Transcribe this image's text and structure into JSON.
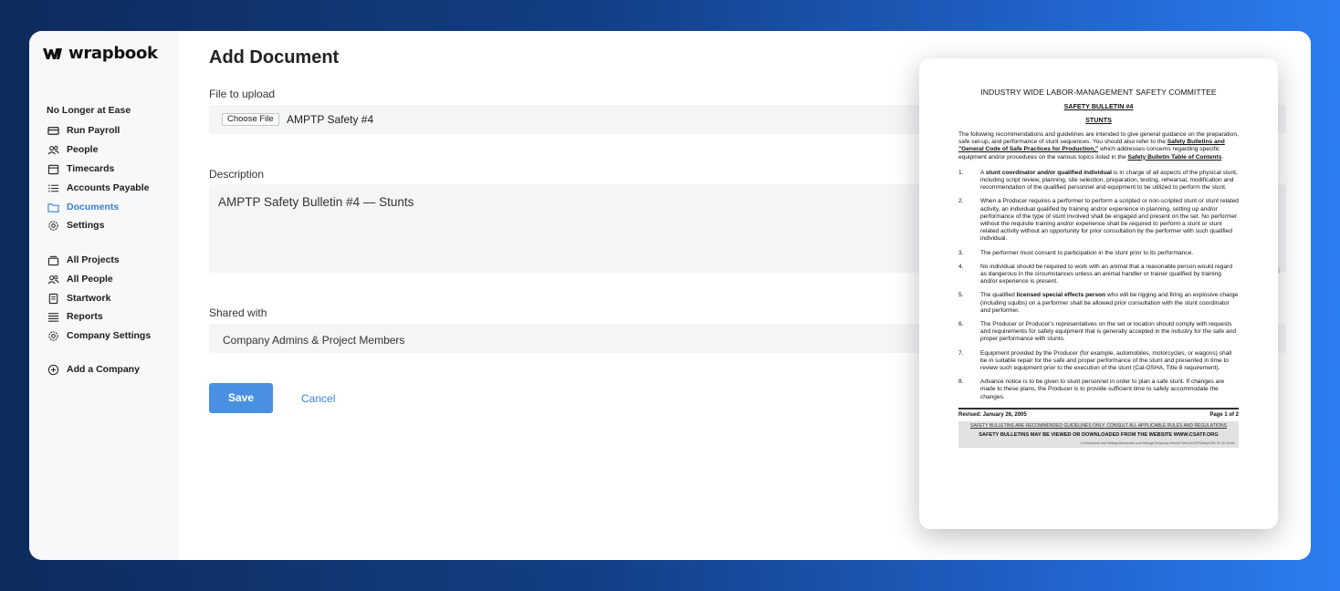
{
  "app": {
    "name": "wrapbook"
  },
  "sidebar": {
    "project_title": "No Longer at Ease",
    "project_items": [
      {
        "label": "Run Payroll",
        "icon": "card-icon"
      },
      {
        "label": "People",
        "icon": "people-icon"
      },
      {
        "label": "Timecards",
        "icon": "calendar-icon"
      },
      {
        "label": "Accounts Payable",
        "icon": "list-icon"
      },
      {
        "label": "Documents",
        "icon": "folder-icon",
        "active": true
      },
      {
        "label": "Settings",
        "icon": "gear-icon"
      }
    ],
    "company_items": [
      {
        "label": "All Projects",
        "icon": "projects-icon"
      },
      {
        "label": "All People",
        "icon": "people-icon"
      },
      {
        "label": "Startwork",
        "icon": "document-icon"
      },
      {
        "label": "Reports",
        "icon": "lines-icon"
      },
      {
        "label": "Company Settings",
        "icon": "gear-icon"
      }
    ],
    "add_company": {
      "label": "Add a Company",
      "icon": "plus-circle-icon"
    }
  },
  "form": {
    "title": "Add Document",
    "file_label": "File to upload",
    "file_button": "Choose File",
    "file_name": "AMPTP Safety #4",
    "description_label": "Description",
    "description_value": "AMPTP Safety Bulletin #4 — Stunts",
    "shared_label": "Shared with",
    "shared_value": "Company Admins & Project Members",
    "save_label": "Save",
    "cancel_label": "Cancel"
  },
  "preview": {
    "heading": "INDUSTRY WIDE LABOR-MANAGEMENT SAFETY COMMITTEE",
    "bulletin": "SAFETY BULLETIN #4",
    "subject": "STUNTS",
    "intro_1": "The following recommendations and guidelines are intended to give general guidance on the preparation, safe set-up, and performance of stunt sequences. You should also refer to the ",
    "intro_link_1": "Safety Bulletins and \"General Code of Safe Practices for Production,\"",
    "intro_2": " which addresses concerns regarding specific equipment and/or procedures on the various topics listed in the ",
    "intro_link_2": "Safety Bulletin Table of Contents",
    "intro_3": ".",
    "items": [
      {
        "num": "1.",
        "pre": "A ",
        "bold": "stunt coordinator and/or qualified individual",
        "post": " is in charge of all aspects of the physical stunt, including script review, planning, site selection, preparation, testing, rehearsal, modification and recommendation of the qualified personnel and equipment to be utilized to perform the stunt."
      },
      {
        "num": "2.",
        "pre": "When a Producer requires a performer to perform a scripted or non-scripted stunt or stunt related activity, an individual qualified by training and/or experience in planning, setting up and/or performance of the type of stunt involved shall be engaged and present on the set.  No performer without the requisite training and/or experience shall be required to perform a stunt or stunt related activity without an opportunity for prior consultation by the performer with such qualified individual.",
        "bold": "",
        "post": ""
      },
      {
        "num": "3.",
        "pre": "The performer must consent to participation in the stunt prior to its performance.",
        "bold": "",
        "post": ""
      },
      {
        "num": "4.",
        "pre": "No individual should be required to work with an animal that a reasonable person would regard as dangerous in the circumstances unless an animal handler or trainer qualified by training and/or experience is present.",
        "bold": "",
        "post": ""
      },
      {
        "num": "5.",
        "pre": "The qualified ",
        "bold": "licensed special effects person",
        "post": " who will be rigging and firing an explosive charge (including squibs) on a performer shall be allowed prior consultation with the stunt coordinator and performer."
      },
      {
        "num": "6.",
        "pre": "The Producer or Producer's representatives on the set or location should comply with requests and requirements for safety equipment that is generally accepted in the industry for the safe and proper performance with stunts.",
        "bold": "",
        "post": ""
      },
      {
        "num": "7.",
        "pre": "Equipment provided by the Producer (for example, automobiles, motorcycles, or wagons) shall be in suitable repair for the safe and proper performance of the stunt and presented in time to review such equipment prior to the execution of the stunt (Cal-OSHA, Title 8 requirement).",
        "bold": "",
        "post": ""
      },
      {
        "num": "8.",
        "pre": "Advance notice is to be given to stunt personnel in order to plan a safe stunt.  If changes are made to these plans, the Producer is to provide sufficient time to safely accommodate the changes.",
        "bold": "",
        "post": ""
      }
    ],
    "revised": "Revised:  January 26, 2005",
    "page": "Page 1 of 2",
    "disclaimer": "SAFETY BULLETINS ARE RECOMMENDED GUIDELINES ONLY. CONSULT ALL APPLICABLE RULES AND REGULATIONS",
    "website": "SAFETY BULLETINS MAY BE VIEWED OR DOWNLOADED FROM THE WEBSITE WWW.CSATF.ORG",
    "path": "C:\\Documents and Settings\\Sherwood\\Local Settings\\Temporary Internet Files\\OLK4F\\Safety4 Rev 01-26-05.doc"
  },
  "colors": {
    "accent": "#3b82d6",
    "save_button": "#4a90e2"
  }
}
